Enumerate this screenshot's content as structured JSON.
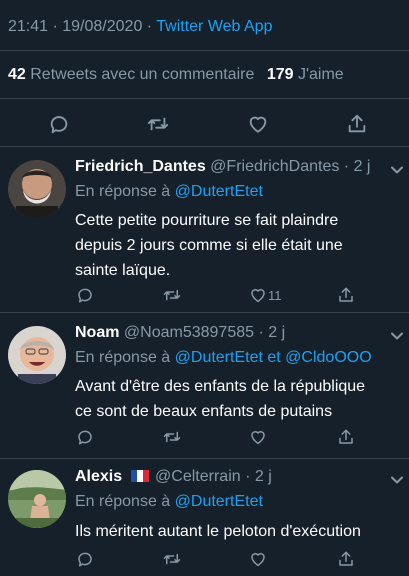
{
  "detail": {
    "timestamp": "21:41 · 19/08/2020 ·",
    "app": "Twitter Web App",
    "retweets_count": "42",
    "retweets_label": "Retweets avec un commentaire",
    "likes_count": "179",
    "likes_label": "J'aime"
  },
  "replies": [
    {
      "name": "Friedrich_Dantes",
      "handle": "@FriedrichDantes",
      "time": "· 2 j",
      "reply_prefix": "En réponse à",
      "mention1": "@DutertEtet",
      "lines": [
        "Cette petite pourriture se fait plaindre",
        "depuis 2 jours comme si elle était une",
        "sainte laïque."
      ],
      "like_count": "11"
    },
    {
      "name": "Noam",
      "handle": "@Noam53897585",
      "time": "· 2 j",
      "reply_prefix": "En réponse à",
      "mention1": "@DutertEtet",
      "joiner": "et",
      "mention2": "@CldoOOO",
      "lines": [
        "Avant d'être des enfants de la république",
        "ce sont de beaux enfants de putains"
      ]
    },
    {
      "name": "Alexis",
      "handle": "@Celterrain",
      "time": "· 2 j",
      "reply_prefix": "En réponse à",
      "mention1": "@DutertEtet",
      "lines": [
        "Ils méritent autant le peloton d'exécution"
      ]
    }
  ],
  "colors": {
    "background": "#15202b",
    "accent": "#1da1f2",
    "secondary_text": "#8899a6",
    "divider": "#38444d"
  }
}
